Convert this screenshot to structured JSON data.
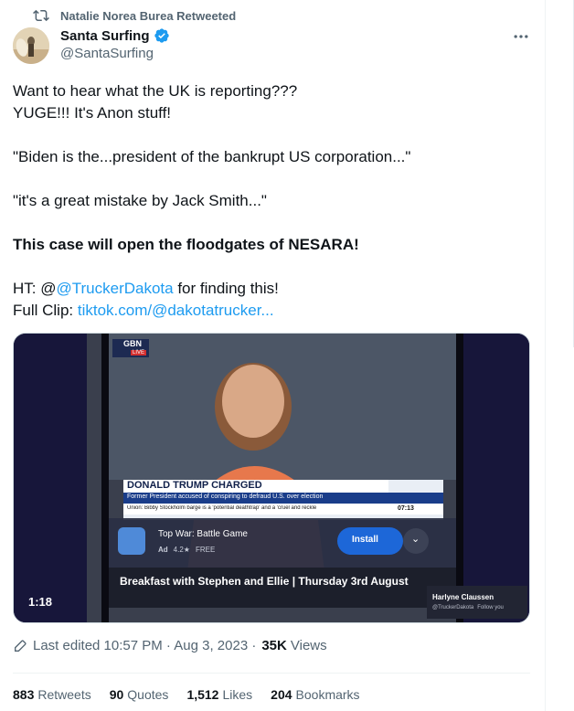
{
  "retweet_header": {
    "text": "Natalie Norea Burea Retweeted"
  },
  "author": {
    "display_name": "Santa Surfing",
    "handle": "@SantaSurfing"
  },
  "tweet": {
    "line1": "Want to hear what the UK is reporting???",
    "line2": "YUGE!!!  It's Anon stuff!",
    "line3": "\"Biden is the...president of the bankrupt US corporation...\"",
    "line4": "\"it's a great mistake by Jack Smith...\"",
    "line5_bold": "This case will open the floodgates of NESARA!",
    "ht_prefix": "HT: @",
    "ht_link": "@TruckerDakota",
    "ht_suffix": " for finding this!",
    "clip_prefix": "Full Clip: ",
    "clip_link": "tiktok.com/@dakotatrucker..."
  },
  "video": {
    "duration": "1:18",
    "channel_logo": "GBN",
    "live_badge": "LIVE",
    "lower_third_headline": "DONALD TRUMP CHARGED",
    "lower_third_sub": "Former President accused of conspiring to defraud U.S. over election",
    "ticker": "Union: Bibby Stockholm barge is a 'potential deathtrap' and a 'cruel and reckle",
    "ticker_time": "07:13",
    "ad_title": "Top War: Battle Game",
    "ad_label": "Ad",
    "ad_rating": "4.2★",
    "ad_price": "FREE",
    "ad_button": "Install",
    "caption": "Breakfast with Stephen and Ellie | Thursday 3rd August",
    "creator_name": "Harlyne Claussen",
    "creator_handle": "@TruckerDakota",
    "creator_tag": "Follow you"
  },
  "meta": {
    "edited": "Last edited 10:57 PM · Aug 3, 2023 ·",
    "views_count": "35K",
    "views_label": "Views"
  },
  "stats": [
    {
      "count": "883",
      "label": "Retweets"
    },
    {
      "count": "90",
      "label": "Quotes"
    },
    {
      "count": "1,512",
      "label": "Likes"
    },
    {
      "count": "204",
      "label": "Bookmarks"
    }
  ],
  "colors": {
    "link": "#1d9bf0",
    "verified": "#1d9bf0",
    "secondary_text": "#536471"
  }
}
